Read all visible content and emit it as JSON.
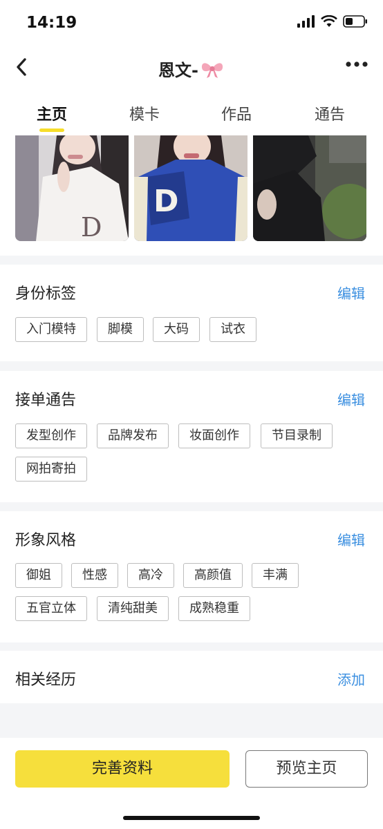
{
  "status_bar": {
    "time": "14:19"
  },
  "nav": {
    "title": "恩文-"
  },
  "tabs": [
    {
      "label": "主页"
    },
    {
      "label": "模卡"
    },
    {
      "label": "作品"
    },
    {
      "label": "通告"
    }
  ],
  "sections": {
    "identity": {
      "title": "身份标签",
      "action": "编辑",
      "tags": [
        "入门模特",
        "脚模",
        "大码",
        "试衣"
      ]
    },
    "orders": {
      "title": "接单通告",
      "action": "编辑",
      "tags": [
        "发型创作",
        "品牌发布",
        "妆面创作",
        "节目录制",
        "网拍寄拍"
      ]
    },
    "style": {
      "title": "形象风格",
      "action": "编辑",
      "tags": [
        "御姐",
        "性感",
        "高冷",
        "高颜值",
        "丰满",
        "五官立体",
        "清纯甜美",
        "成熟稳重"
      ]
    },
    "experience": {
      "title": "相关经历",
      "action": "添加"
    }
  },
  "bottom": {
    "primary_label": "完善资料",
    "secondary_label": "预览主页"
  },
  "colors": {
    "accent_yellow": "#f6df3c",
    "link_blue": "#3b8fe0"
  }
}
